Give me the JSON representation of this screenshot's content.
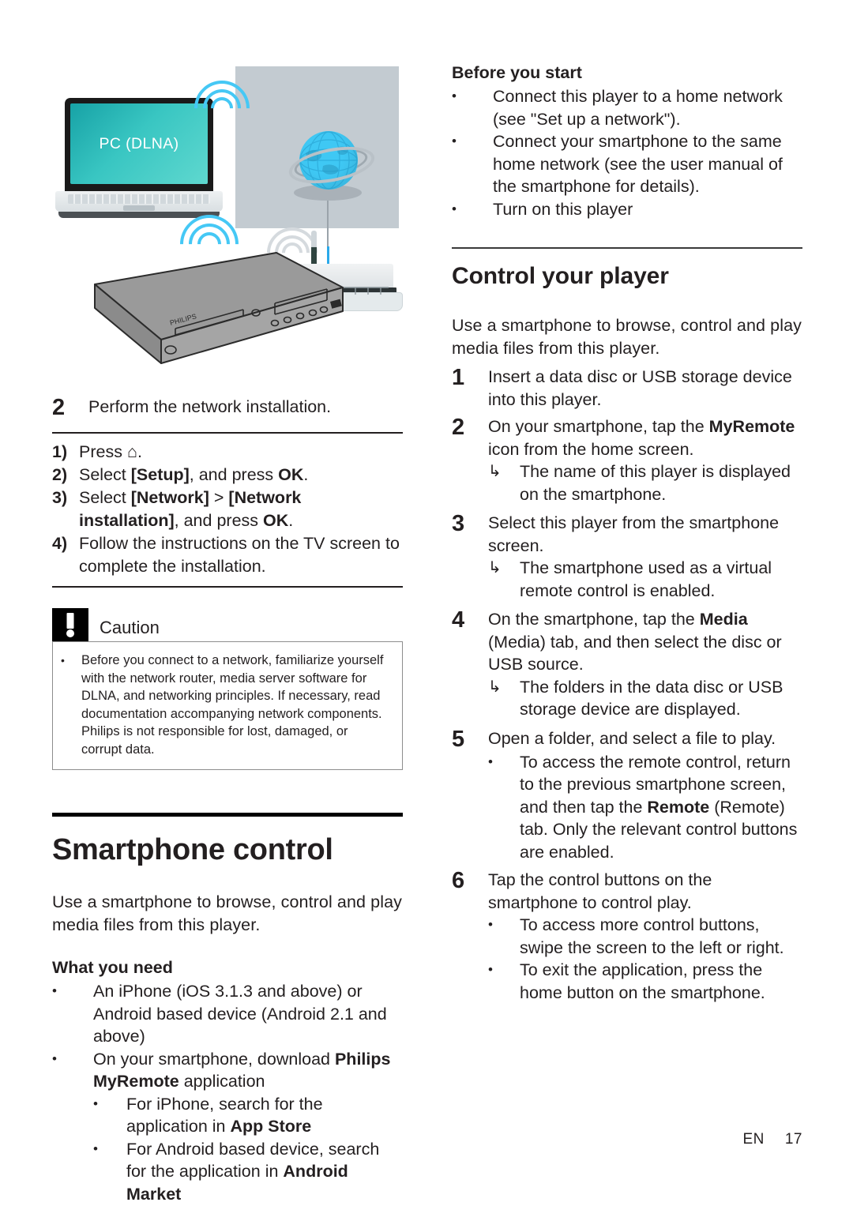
{
  "illustration": {
    "laptop_screen_label": "PC (DLNA)",
    "device_brand": "PHILIPS",
    "icons": [
      "wifi-waves-icon",
      "globe-icon",
      "router-icon",
      "laptop-icon",
      "disc-player-icon"
    ]
  },
  "left_column": {
    "step2": {
      "number": "2",
      "text": "Perform the network installation."
    },
    "substeps": [
      {
        "marker": "1)",
        "text": "Press ",
        "suffix": ".",
        "icon": "home-icon",
        "bold_parts": []
      },
      {
        "marker": "2)",
        "text_parts": [
          {
            "t": "Select ",
            "b": false
          },
          {
            "t": "[Setup]",
            "b": true
          },
          {
            "t": ", and press ",
            "b": false
          },
          {
            "t": "OK",
            "b": true
          },
          {
            "t": ".",
            "b": false
          }
        ]
      },
      {
        "marker": "3)",
        "text_parts": [
          {
            "t": "Select ",
            "b": false
          },
          {
            "t": "[Network]",
            "b": true
          },
          {
            "t": " > ",
            "b": false
          },
          {
            "t": "[Network installation]",
            "b": true
          },
          {
            "t": ", and press ",
            "b": false
          },
          {
            "t": "OK",
            "b": true
          },
          {
            "t": ".",
            "b": false
          }
        ]
      },
      {
        "marker": "4)",
        "text_parts": [
          {
            "t": "Follow the instructions on the TV screen to complete the installation.",
            "b": false
          }
        ]
      }
    ],
    "caution": {
      "title": "Caution",
      "icon": "exclamation-icon",
      "items": [
        "Before you connect to a network, familiarize yourself with the network router, media server software for DLNA, and networking principles. If necessary, read documentation accompanying network components. Philips is not responsible for lost, damaged, or corrupt data."
      ]
    },
    "chapter": {
      "title": "Smartphone control",
      "intro": "Use a smartphone to browse, control and play media files from this player.",
      "what_you_need_title": "What you need",
      "bullets": [
        {
          "parts": [
            {
              "t": "An iPhone (iOS 3.1.3 and above) or Android based device (Android 2.1 and above)",
              "b": false
            }
          ]
        },
        {
          "parts": [
            {
              "t": "On your smartphone, download ",
              "b": false
            },
            {
              "t": "Philips MyRemote",
              "b": true
            },
            {
              "t": " application",
              "b": false
            }
          ],
          "sub": [
            {
              "parts": [
                {
                  "t": "For iPhone, search for the application in ",
                  "b": false
                },
                {
                  "t": "App Store",
                  "b": true
                }
              ]
            },
            {
              "parts": [
                {
                  "t": "For Android based device, search for the application in ",
                  "b": false
                },
                {
                  "t": "Android Market",
                  "b": true
                }
              ]
            }
          ]
        }
      ]
    }
  },
  "right_column": {
    "before_you_start_title": "Before you start",
    "before_you_start_bullets": [
      "Connect this player to a home network (see \"Set up a network\").",
      "Connect your smartphone to the same home network (see the user manual of the smartphone for details).",
      "Turn on this player"
    ],
    "section_title": "Control your player",
    "section_intro": "Use a smartphone to browse, control and play media files from this player.",
    "steps": [
      {
        "number": "1",
        "parts": [
          {
            "t": "Insert a data disc or USB storage device into this player.",
            "b": false
          }
        ],
        "results": []
      },
      {
        "number": "2",
        "parts": [
          {
            "t": "On your smartphone, tap the ",
            "b": false
          },
          {
            "t": "MyRemote",
            "b": true
          },
          {
            "t": " icon from the home screen.",
            "b": false
          }
        ],
        "results": [
          "The name of this player is displayed on the smartphone."
        ]
      },
      {
        "number": "3",
        "parts": [
          {
            "t": "Select this player from the smartphone screen.",
            "b": false
          }
        ],
        "results": [
          "The smartphone used as a virtual remote control is enabled."
        ]
      },
      {
        "number": "4",
        "parts": [
          {
            "t": "On the smartphone, tap the ",
            "b": false
          },
          {
            "t": "Media",
            "b": true
          },
          {
            "t": " (Media) tab, and then select the disc or USB source.",
            "b": false
          }
        ],
        "results": [
          "The folders in the data disc or USB storage device are displayed."
        ]
      },
      {
        "number": "5",
        "parts": [
          {
            "t": "Open a folder, and select a file to play.",
            "b": false
          }
        ],
        "results": [],
        "bullets": [
          {
            "parts": [
              {
                "t": "To access the remote control, return to the previous smartphone screen, and then tap the ",
                "b": false
              },
              {
                "t": "Remote",
                "b": true
              },
              {
                "t": " (Remote) tab. Only the relevant control buttons are enabled.",
                "b": false
              }
            ]
          }
        ]
      },
      {
        "number": "6",
        "parts": [
          {
            "t": "Tap the control buttons on the smartphone to control play.",
            "b": false
          }
        ],
        "results": [],
        "bullets": [
          {
            "parts": [
              {
                "t": "To access more control buttons, swipe the screen to the left or right.",
                "b": false
              }
            ]
          },
          {
            "parts": [
              {
                "t": "To exit the application, press the home button on the smartphone.",
                "b": false
              }
            ]
          }
        ]
      }
    ]
  },
  "footer": {
    "language": "EN",
    "page_number": "17"
  },
  "glyphs": {
    "bullet": "•",
    "arrow": "↳",
    "home": "⌂"
  },
  "colors": {
    "text": "#231f20",
    "panel": "#c3cbd1",
    "globe": "#3fc8f4",
    "wifi": "#45c8f5",
    "screen": "#39c6c2"
  }
}
